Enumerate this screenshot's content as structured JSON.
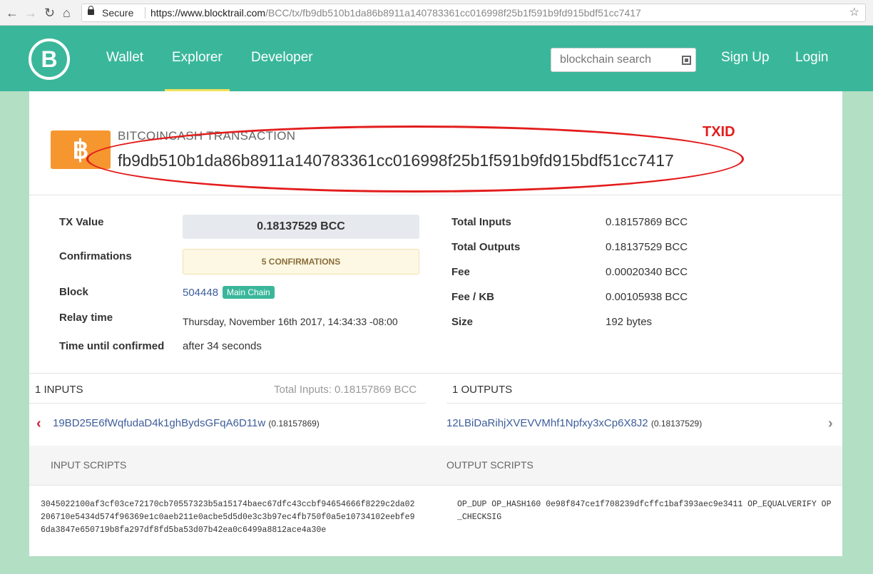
{
  "browser": {
    "secure_label": "Secure",
    "url_host": "https://www.blocktrail.com",
    "url_path": "/BCC/tx/fb9db510b1da86b8911a140783361cc016998f25b1f591b9fd915bdf51cc7417",
    "back_icon": "back-arrow-icon",
    "forward_icon": "forward-arrow-icon",
    "reload_icon": "reload-icon",
    "home_icon": "home-icon",
    "star_icon": "bookmark-star-icon"
  },
  "header": {
    "logo_letter": "B",
    "nav": [
      "Wallet",
      "Explorer",
      "Developer"
    ],
    "active_nav": "Explorer",
    "search_placeholder": "blockchain search",
    "sign_up": "Sign Up",
    "login": "Login",
    "colors": {
      "header_bg": "#3ab79b",
      "active_underline": "#f3e15a"
    }
  },
  "transaction": {
    "coin_symbol": "฿",
    "kind": "BITCOINCASH TRANSACTION",
    "txid": "fb9db510b1da86b8911a140783361cc016998f25b1f591b9fd915bdf51cc7417",
    "txid_annotation": "TXID"
  },
  "details_left": {
    "tx_value_label": "TX Value",
    "tx_value": "0.18137529 BCC",
    "confirmations_label": "Confirmations",
    "confirmations": "5 CONFIRMATIONS",
    "block_label": "Block",
    "block": "504448",
    "block_badge": "Main Chain",
    "relay_label": "Relay time",
    "relay_time": "Thursday, November 16th 2017, 14:34:33 -08:00",
    "time_until_label": "Time until confirmed",
    "time_until": "after 34 seconds"
  },
  "details_right": {
    "total_inputs_label": "Total Inputs",
    "total_inputs": "0.18157869 BCC",
    "total_outputs_label": "Total Outputs",
    "total_outputs": "0.18137529 BCC",
    "fee_label": "Fee",
    "fee": "0.00020340 BCC",
    "fee_kb_label": "Fee / KB",
    "fee_kb": "0.00105938 BCC",
    "size_label": "Size",
    "size": "192 bytes"
  },
  "inputs": {
    "header": "1 INPUTS",
    "total": "Total Inputs: 0.18157869 BCC",
    "items": [
      {
        "address": "19BD25E6fWqfudaD4k1ghBydsGFqA6D11w",
        "amount": "(0.18157869)"
      }
    ]
  },
  "outputs": {
    "header": "1 OUTPUTS",
    "items": [
      {
        "address": "12LBiDaRihjXVEVVMhf1Npfxy3xCp6X8J2",
        "amount": "(0.18137529)"
      }
    ]
  },
  "scripts": {
    "input_title": "INPUT SCRIPTS",
    "output_title": "OUTPUT SCRIPTS",
    "input_script": "3045022100af3cf03ce72170cb70557323b5a15174baec67dfc43ccbf94654666f8229c2da02206710e5434d574f96369e1c0aeb211e0acbe5d5d0e3c3b97ec4fb750f0a5e10734102eebfe96da3847e650719b8fa297df8fd5ba53d07b42ea0c6499a8812ace4a30e",
    "output_script": "OP_DUP OP_HASH160 0e98f847ce1f708239dfcffc1baf393aec9e3411 OP_EQUALVERIFY OP_CHECKSIG"
  }
}
